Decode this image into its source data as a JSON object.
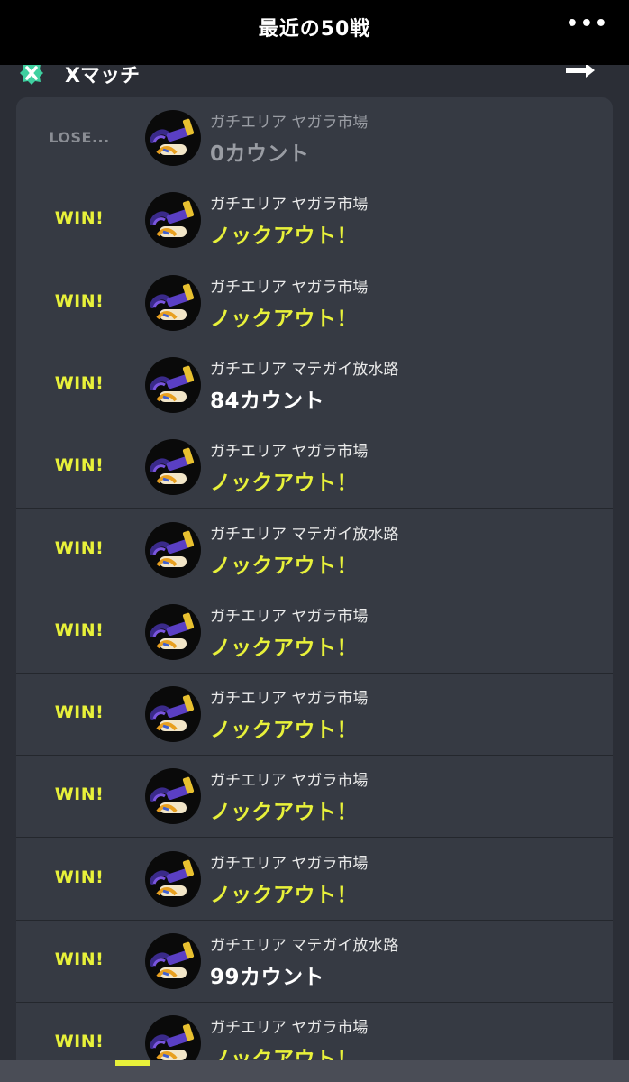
{
  "header": {
    "title": "最近の50戦",
    "more_label": "•••"
  },
  "subheader": {
    "mode_label": "Xマッチ"
  },
  "colors": {
    "win": "#e8f13a",
    "lose": "#8a8d94",
    "panel": "#363a43",
    "background": "#2b2e36",
    "topbar": "#000000"
  },
  "icons": {
    "mode": "x-match-icon",
    "share": "arrow-right-icon",
    "weapon": "weapon-icon"
  },
  "battles": [
    {
      "result": "LOSE...",
      "stage": "ガチエリア ヤガラ市場",
      "outcome": "0カウント",
      "kind": "lose"
    },
    {
      "result": "WIN!",
      "stage": "ガチエリア ヤガラ市場",
      "outcome": "ノックアウト！",
      "kind": "win"
    },
    {
      "result": "WIN!",
      "stage": "ガチエリア ヤガラ市場",
      "outcome": "ノックアウト！",
      "kind": "win"
    },
    {
      "result": "WIN!",
      "stage": "ガチエリア マテガイ放水路",
      "outcome": "84カウント",
      "kind": "count"
    },
    {
      "result": "WIN!",
      "stage": "ガチエリア ヤガラ市場",
      "outcome": "ノックアウト！",
      "kind": "win"
    },
    {
      "result": "WIN!",
      "stage": "ガチエリア マテガイ放水路",
      "outcome": "ノックアウト！",
      "kind": "win"
    },
    {
      "result": "WIN!",
      "stage": "ガチエリア ヤガラ市場",
      "outcome": "ノックアウト！",
      "kind": "win"
    },
    {
      "result": "WIN!",
      "stage": "ガチエリア ヤガラ市場",
      "outcome": "ノックアウト！",
      "kind": "win"
    },
    {
      "result": "WIN!",
      "stage": "ガチエリア ヤガラ市場",
      "outcome": "ノックアウト！",
      "kind": "win"
    },
    {
      "result": "WIN!",
      "stage": "ガチエリア ヤガラ市場",
      "outcome": "ノックアウト！",
      "kind": "win"
    },
    {
      "result": "WIN!",
      "stage": "ガチエリア マテガイ放水路",
      "outcome": "99カウント",
      "kind": "count"
    },
    {
      "result": "WIN!",
      "stage": "ガチエリア ヤガラ市場",
      "outcome": "ノックアウト！",
      "kind": "win"
    }
  ]
}
